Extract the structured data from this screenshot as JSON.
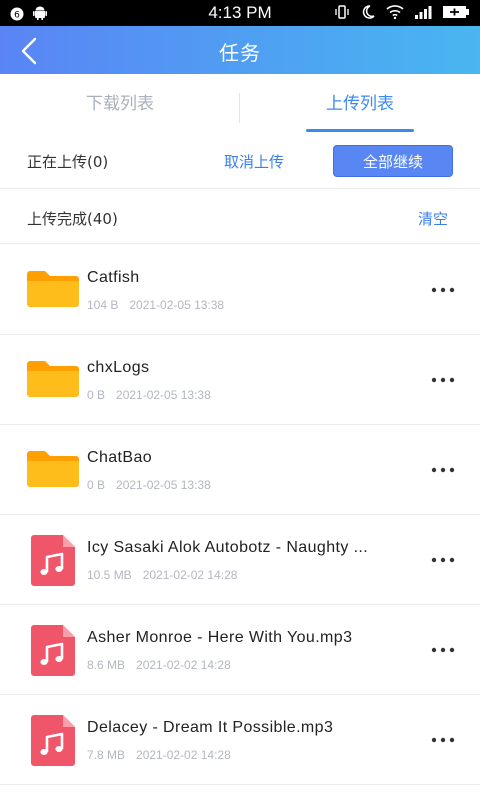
{
  "status_bar": {
    "time": "4:13 PM"
  },
  "header": {
    "title": "任务"
  },
  "tabs": [
    {
      "label": "下载列表",
      "active": false
    },
    {
      "label": "上传列表",
      "active": true
    }
  ],
  "uploading": {
    "label": "正在上传(0)",
    "cancel_label": "取消上传",
    "continue_all_label": "全部继续"
  },
  "completed": {
    "label": "上传完成(40)",
    "clear_label": "清空"
  },
  "files": [
    {
      "name": "Catfish",
      "size": "104 B",
      "date": "2021-02-05 13:38",
      "type": "folder"
    },
    {
      "name": "chxLogs",
      "size": "0 B",
      "date": "2021-02-05 13:38",
      "type": "folder"
    },
    {
      "name": "ChatBao",
      "size": "0 B",
      "date": "2021-02-05 13:38",
      "type": "folder"
    },
    {
      "name": "Icy Sasaki Alok Autobotz - Naughty ...",
      "size": "10.5 MB",
      "date": "2021-02-02 14:28",
      "type": "music"
    },
    {
      "name": "Asher Monroe - Here With You.mp3",
      "size": "8.6 MB",
      "date": "2021-02-02 14:28",
      "type": "music"
    },
    {
      "name": "Delacey - Dream It Possible.mp3",
      "size": "7.8 MB",
      "date": "2021-02-02 14:28",
      "type": "music"
    }
  ],
  "colors": {
    "accent": "#3b8af3",
    "folder": "#ffb300",
    "music": "#f0566a"
  }
}
